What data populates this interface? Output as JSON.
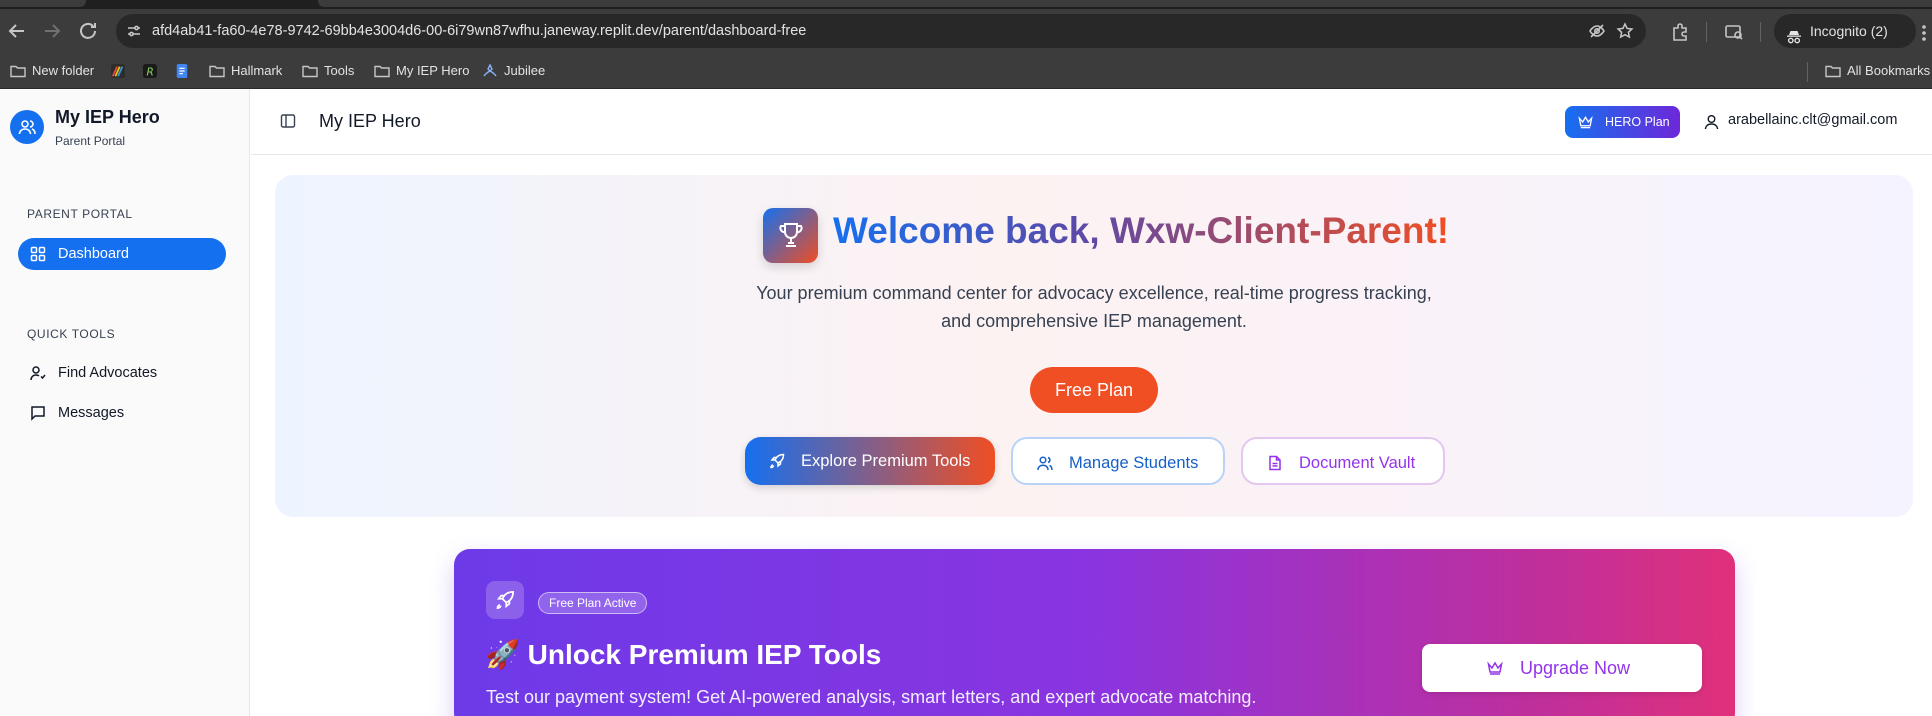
{
  "browser": {
    "url": "afd4ab41-fa60-4e78-9742-69bb4e3004d6-00-6i79wn87wfhu.janeway.replit.dev/parent/dashboard-free",
    "incognito_label": "Incognito (2)",
    "bookmarks": [
      {
        "label": "New folder",
        "icon": "folder-icon"
      },
      {
        "label": "",
        "icon": "rainbow-app-icon"
      },
      {
        "label": "",
        "icon": "r-app-icon"
      },
      {
        "label": "",
        "icon": "docs-icon"
      },
      {
        "label": "Hallmark",
        "icon": "folder-icon"
      },
      {
        "label": "Tools",
        "icon": "folder-icon"
      },
      {
        "label": "My IEP Hero",
        "icon": "folder-icon"
      },
      {
        "label": "Jubilee",
        "icon": "jubilee-icon"
      }
    ],
    "all_bookmarks_label": "All Bookmarks"
  },
  "sidebar": {
    "app_title": "My IEP Hero",
    "app_subtitle": "Parent Portal",
    "sections": [
      {
        "label": "PARENT PORTAL",
        "items": [
          {
            "label": "Dashboard",
            "active": true,
            "icon": "dashboard-icon"
          }
        ]
      },
      {
        "label": "QUICK TOOLS",
        "items": [
          {
            "label": "Find Advocates",
            "active": false,
            "icon": "user-search-icon"
          },
          {
            "label": "Messages",
            "active": false,
            "icon": "message-icon"
          }
        ]
      }
    ]
  },
  "topbar": {
    "title": "My IEP Hero",
    "plan_badge": "HERO Plan",
    "user_email": "arabellainc.clt@gmail.com"
  },
  "hero": {
    "title": "Welcome back, Wxw-Client-Parent!",
    "subtitle": "Your premium command center for advocacy excellence, real-time progress tracking, and comprehensive IEP management.",
    "plan_button": "Free Plan",
    "actions": [
      {
        "label": "Explore Premium Tools",
        "icon": "rocket-icon"
      },
      {
        "label": "Manage Students",
        "icon": "users-icon"
      },
      {
        "label": "Document Vault",
        "icon": "document-icon"
      }
    ]
  },
  "promo": {
    "badge": "Free Plan Active",
    "title": "🚀 Unlock Premium IEP Tools",
    "text": "Test our payment system! Get AI-powered analysis, smart letters, and expert advocate matching.",
    "cta": "Upgrade Now"
  },
  "colors": {
    "primary": "#1570ef",
    "accent": "#f04e23",
    "promo_start": "#6d3ae8",
    "promo_end": "#e0307a",
    "vault": "#9333ea"
  }
}
